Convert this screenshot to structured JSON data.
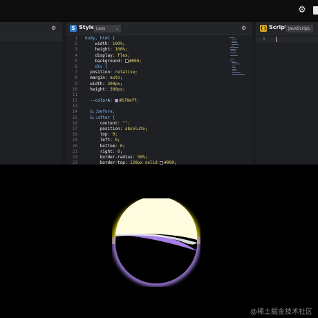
{
  "topbar": {
    "settings_icon": "gear-icon",
    "extra_icon": "file-icon"
  },
  "left_panel": {
    "settings_icon": "gear-icon"
  },
  "style_panel": {
    "badge": "S",
    "badge_color": "#2f7fd0",
    "title": "Style",
    "language": "Less",
    "settings_icon": "gear-icon",
    "lines": [
      {
        "n": "1",
        "text": "body, html {"
      },
      {
        "n": "2",
        "text": "    width: 100%;"
      },
      {
        "n": "3",
        "text": "    height: 100%;"
      },
      {
        "n": "4",
        "text": "    display: flex;"
      },
      {
        "n": "5",
        "text": "    background: #000;"
      },
      {
        "n": "6",
        "text": "    div {"
      },
      {
        "n": "7",
        "text": "  position: relative;"
      },
      {
        "n": "8",
        "text": "  margin: auto;"
      },
      {
        "n": "9",
        "text": "  width: 300px;"
      },
      {
        "n": "10",
        "text": "  height: 300px;"
      },
      {
        "n": "11",
        "text": ""
      },
      {
        "n": "12",
        "text": "  --colorA: #b78eff;"
      },
      {
        "n": "13",
        "text": ""
      },
      {
        "n": "14",
        "text": "  &::before,"
      },
      {
        "n": "15",
        "text": "  &::after {"
      },
      {
        "n": "16",
        "text": "      content: \"\";"
      },
      {
        "n": "17",
        "text": "      position: absolute;"
      },
      {
        "n": "18",
        "text": "      top: 0;"
      },
      {
        "n": "19",
        "text": "      left: 0;"
      },
      {
        "n": "20",
        "text": "      bottom: 0;"
      },
      {
        "n": "21",
        "text": "      right: 0;"
      },
      {
        "n": "22",
        "text": "      border-radius: 50%;"
      },
      {
        "n": "23",
        "text": "      border-top: 120px solid #000;"
      }
    ]
  },
  "script_panel": {
    "badge": "{}",
    "badge_color": "#e0b020",
    "title": "Script",
    "language": "JavaScript",
    "line_number": "1"
  },
  "preview": {
    "glow_yellow": "#fff200",
    "glow_purple": "#b78eff",
    "watermark": "@稀土掘金技术社区"
  }
}
